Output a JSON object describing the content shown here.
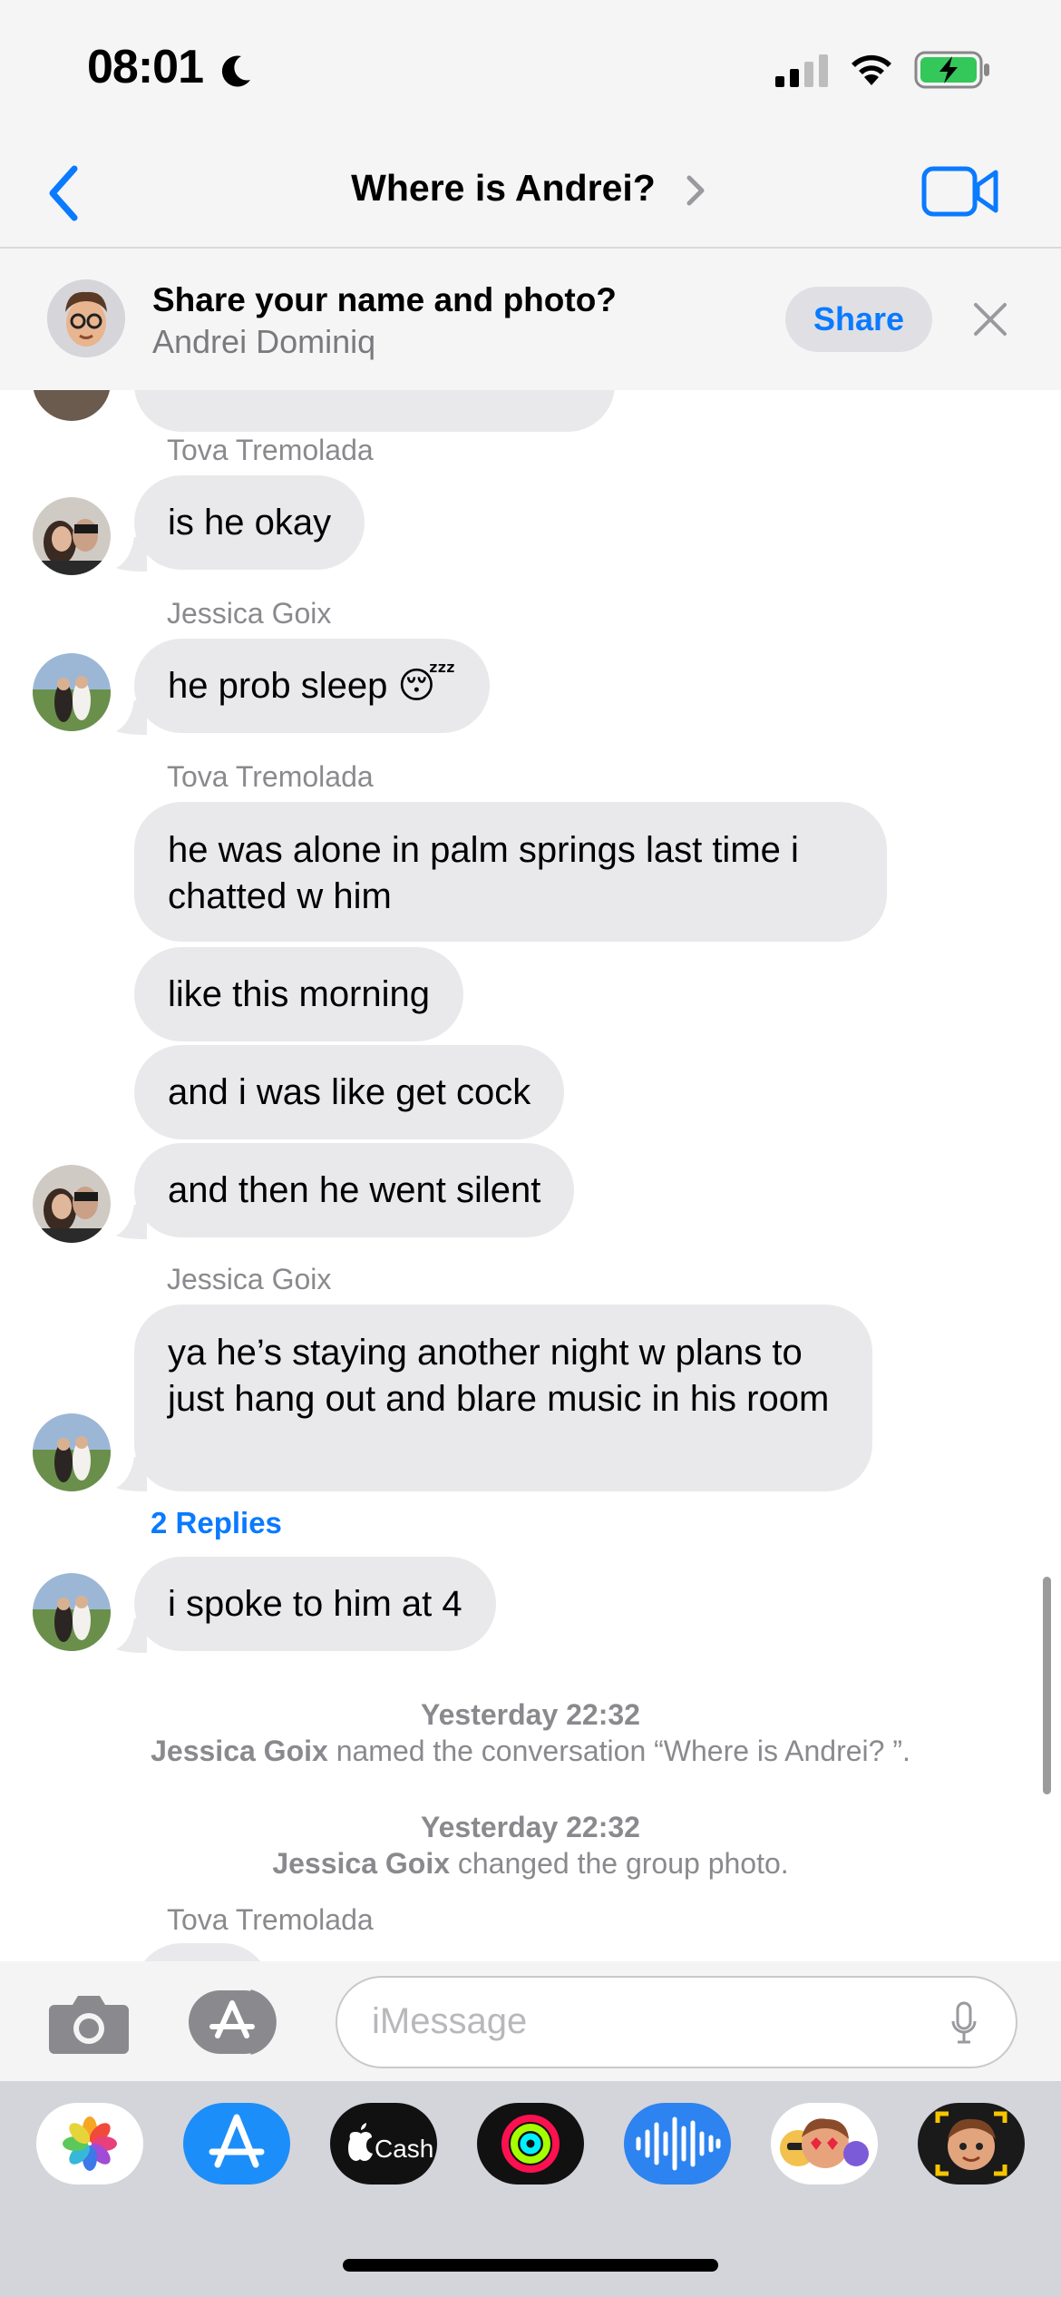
{
  "status_bar": {
    "time": "08:01",
    "moon_icon": "moon-icon",
    "signal_icon": "cellular-signal-icon",
    "wifi_icon": "wifi-icon",
    "battery_icon": "battery-charging-icon"
  },
  "header": {
    "back_icon": "chevron-left-icon",
    "title": "Where is Andrei?",
    "title_chevron_icon": "chevron-right-icon",
    "video_icon": "video-camera-icon",
    "accent": "#0a7aff"
  },
  "share_banner": {
    "title": "Share your name and photo?",
    "subtitle": "Andrei Dominiq",
    "share_label": "Share",
    "close_icon": "close-icon"
  },
  "messages": {
    "m1": {
      "sender": "Tova Tremolada",
      "text": "is he okay"
    },
    "m2": {
      "sender": "Jessica Goix",
      "text": "he prob sleep 😴"
    },
    "m3": {
      "sender": "Tova Tremolada",
      "text": "he was alone in palm springs last time i chatted w him"
    },
    "m4": {
      "text": "like this morning"
    },
    "m5": {
      "text": "and i was like get cock"
    },
    "m6": {
      "text": "and then he went silent"
    },
    "m7": {
      "sender": "Jessica Goix",
      "text": "ya he’s staying another night w plans to just hang out and blare music in his room"
    },
    "replies": "2 Replies",
    "m8": {
      "text": "i spoke to him at 4"
    },
    "last_sender": "Tova Tremolada"
  },
  "system_events": [
    {
      "time": "Yesterday 22:32",
      "actor": "Jessica Goix",
      "action": " named the conversation “Where is Andrei? ”."
    },
    {
      "time": "Yesterday 22:32",
      "actor": "Jessica Goix",
      "action": " changed the group photo."
    }
  ],
  "composer": {
    "camera_icon": "camera-icon",
    "apps_icon": "app-store-icon",
    "placeholder": "iMessage",
    "mic_icon": "microphone-icon"
  },
  "app_drawer": {
    "apps": [
      "photos-app-icon",
      "app-store-app-icon",
      "apple-cash-app-icon",
      "activity-app-icon",
      "audio-message-app-icon",
      "memoji-stickers-app-icon",
      "memoji-camera-app-icon"
    ],
    "cash_label": "Cash"
  },
  "colors": {
    "bubble_gray": "#e9e9eb",
    "link_blue": "#0a7aff",
    "muted_text": "#8a8a8e"
  }
}
